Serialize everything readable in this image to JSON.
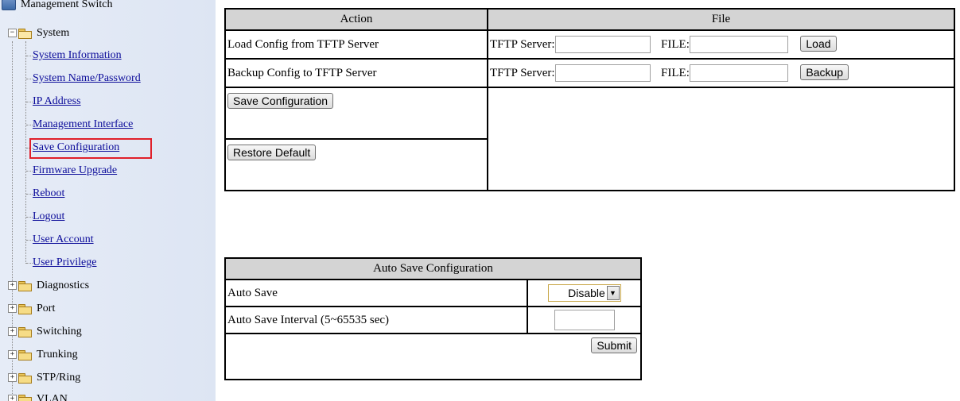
{
  "sidebar": {
    "root": "Management Switch",
    "system": "System",
    "system_items": [
      "System Information",
      "System Name/Password",
      "IP Address",
      "Management Interface",
      "Save Configuration",
      "Firmware Upgrade",
      "Reboot",
      "Logout",
      "User Account",
      "User Privilege"
    ],
    "folders": [
      "Diagnostics",
      "Port",
      "Switching",
      "Trunking",
      "STP/Ring",
      "VLAN"
    ],
    "expand_symbol": "+",
    "collapse_symbol": "−"
  },
  "config_table": {
    "header_action": "Action",
    "header_file": "File",
    "rows": [
      {
        "action": "Load Config from TFTP Server",
        "server_label": "TFTP Server:",
        "server_value": "",
        "file_label": "FILE:",
        "file_value": "",
        "button": "Load"
      },
      {
        "action": "Backup Config to TFTP Server",
        "server_label": "TFTP Server:",
        "server_value": "",
        "file_label": "FILE:",
        "file_value": "",
        "button": "Backup"
      }
    ],
    "save_button": "Save Configuration",
    "restore_button": "Restore Default"
  },
  "auto_save": {
    "title": "Auto Save Configuration",
    "auto_save_label": "Auto Save",
    "auto_save_value": "Disable",
    "interval_label": "Auto Save Interval (5~65535 sec)",
    "interval_value": "",
    "submit_button": "Submit"
  },
  "colors": {
    "highlight": "#e0202a",
    "link": "#0a0a99",
    "header_bg": "#d4d4d4"
  }
}
